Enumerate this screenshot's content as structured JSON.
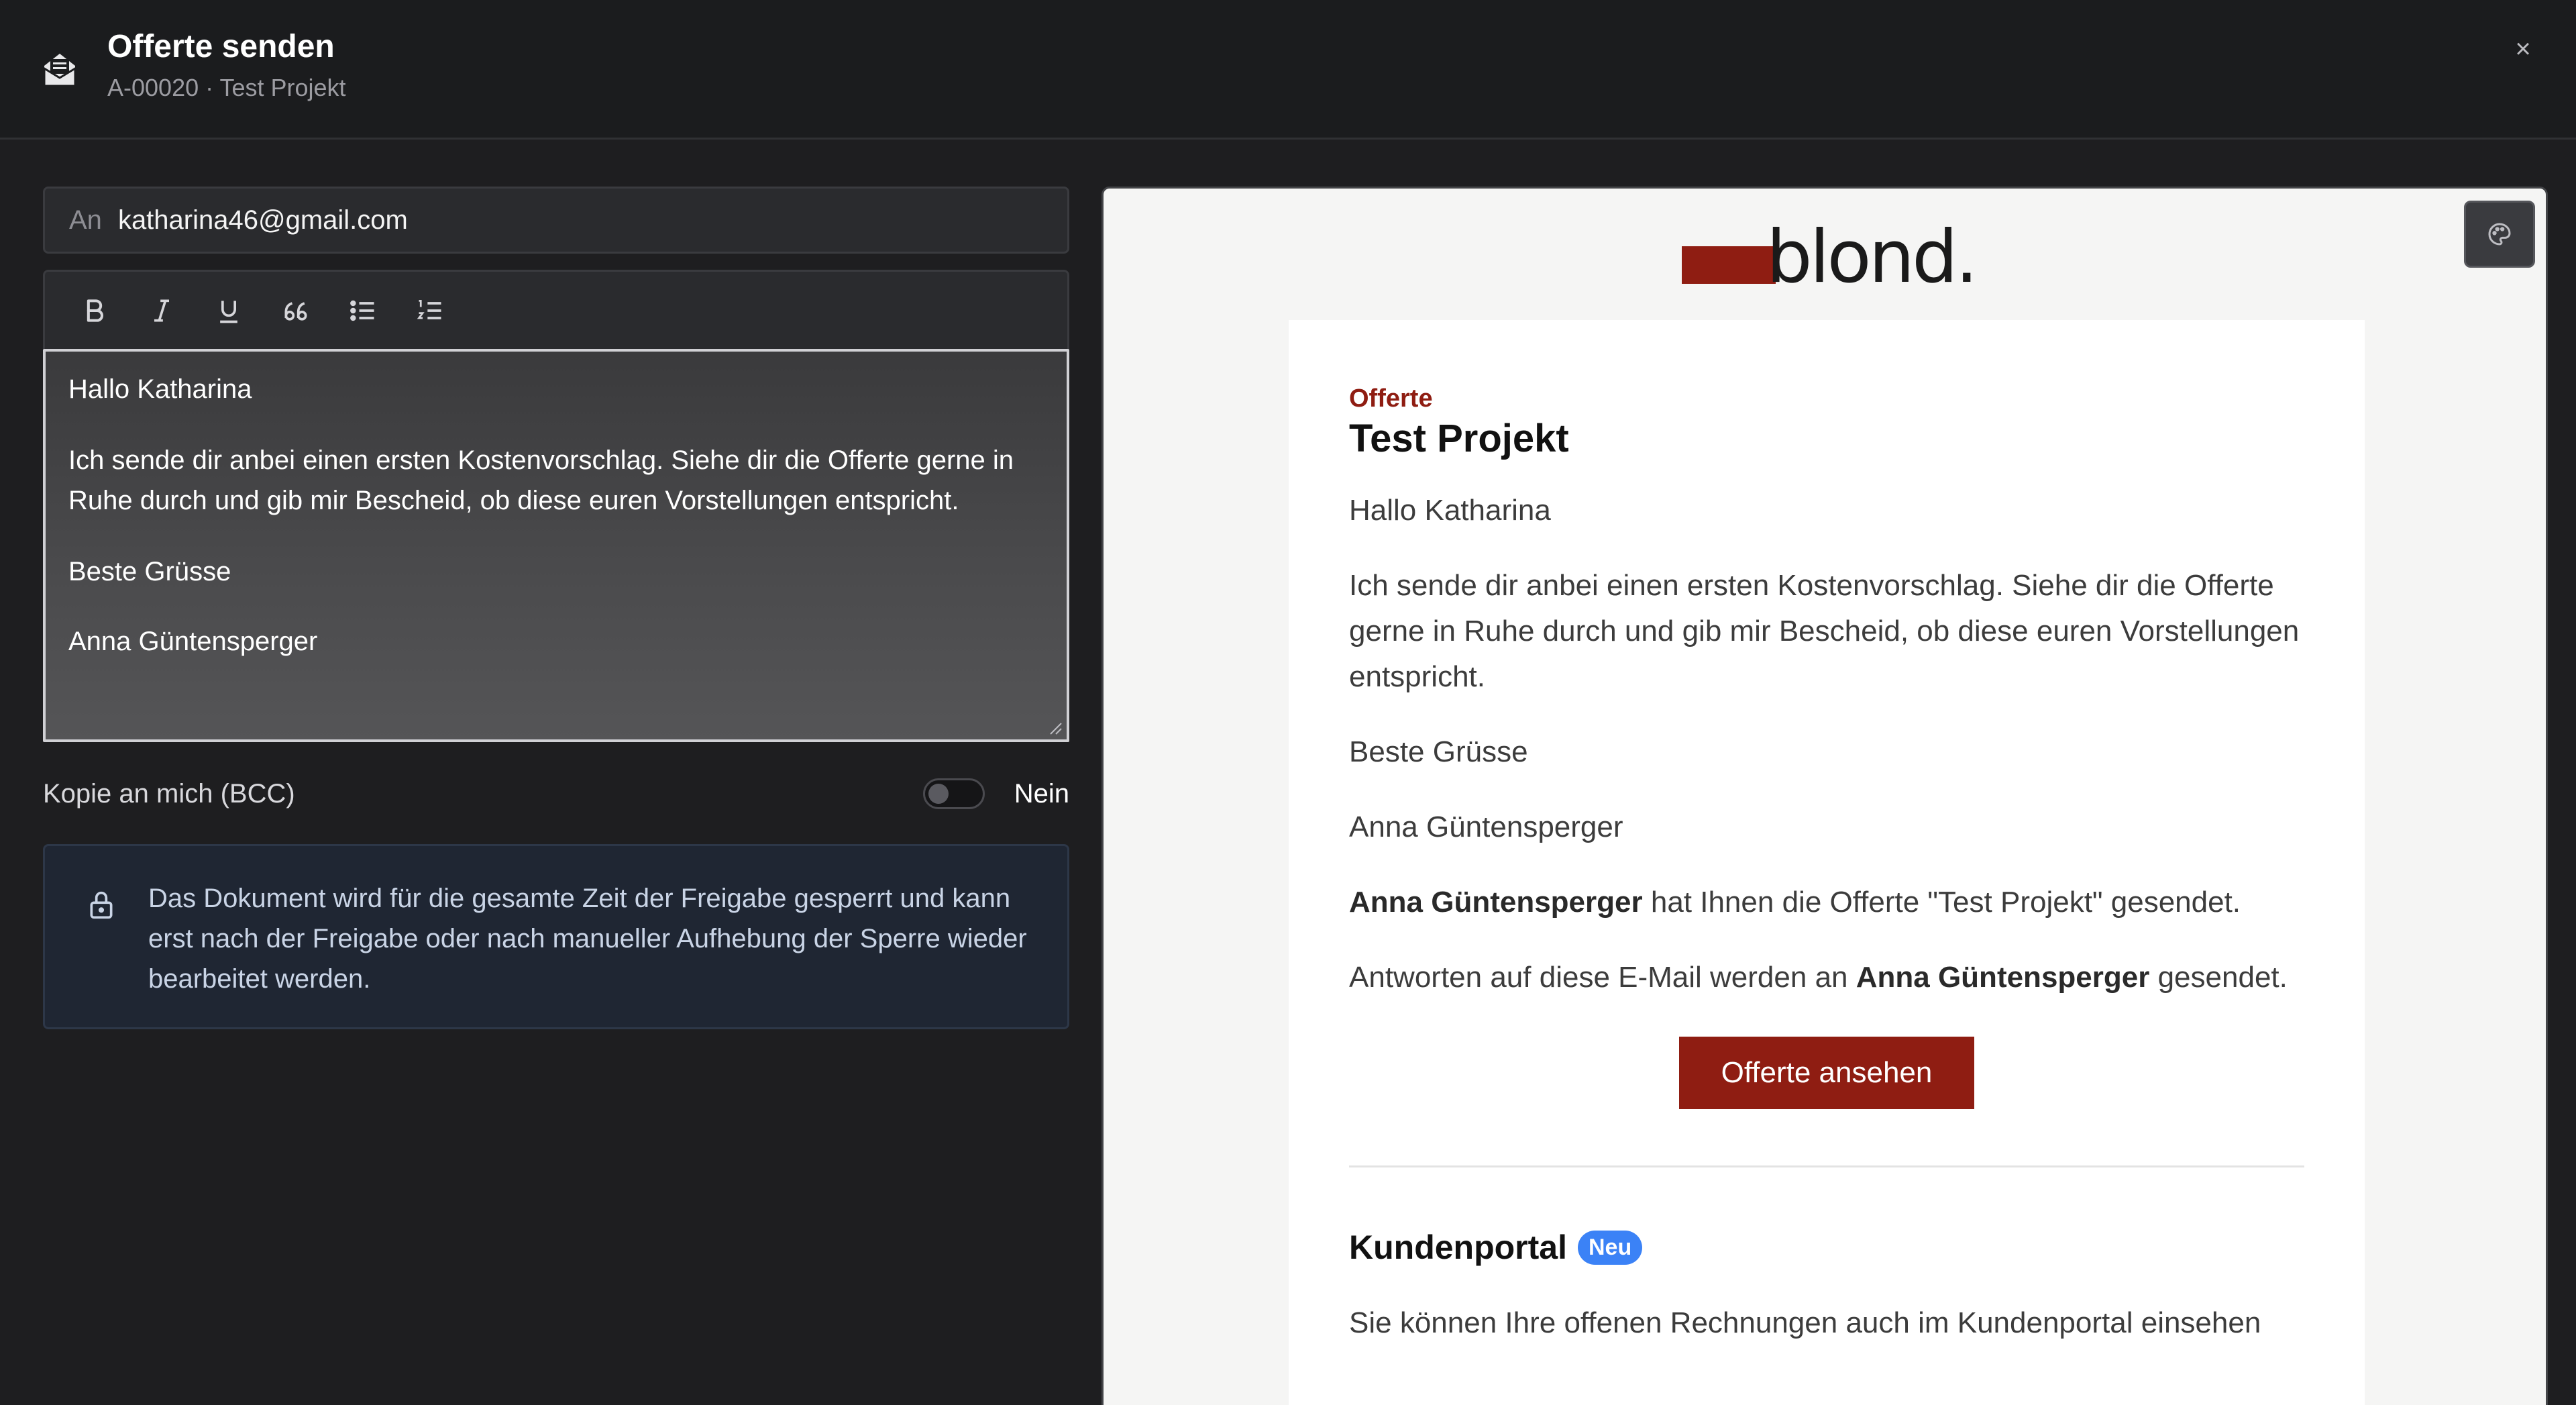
{
  "header": {
    "title": "Offerte senden",
    "subtitle": "A-00020 · Test Projekt",
    "close_glyph": "×",
    "icon": "envelope-open-icon"
  },
  "compose": {
    "to_label": "An",
    "to_value": "katharina46@gmail.com",
    "toolbar": [
      "bold-icon",
      "italic-icon",
      "underline-icon",
      "quote-icon",
      "bullet-list-icon",
      "numbered-list-icon"
    ],
    "body": {
      "greeting": "Hallo Katharina",
      "paragraph": "Ich sende dir anbei einen ersten Kostenvorschlag. Siehe dir die Offerte gerne in Ruhe durch und gib mir Bescheid, ob diese euren Vorstellungen entspricht.",
      "closing": "Beste Grüsse",
      "signature": "Anna Güntensperger"
    },
    "bcc_label": "Kopie an mich (BCC)",
    "bcc_state": "Nein",
    "info_text": "Das Dokument wird für die gesamte Zeit der Freigabe gesperrt und kann erst nach der Freigabe oder nach manueller Aufhebung der Sperre wieder bearbeitet werden."
  },
  "preview": {
    "logo_text": "blond.",
    "brand_color": "#8f1d12",
    "kicker": "Offerte",
    "title": "Test Projekt",
    "greeting": "Hallo Katharina",
    "paragraph": "Ich sende dir anbei einen ersten Kostenvorschlag. Siehe dir die Offerte gerne in Ruhe durch und gib mir Bescheid, ob diese euren Vorstellungen entspricht.",
    "closing": "Beste Grüsse",
    "signature": "Anna Güntensperger",
    "sent_sender": "Anna Güntensperger",
    "sent_rest": " hat Ihnen die Offerte \"Test Projekt\" gesendet.",
    "reply_prefix": "Antworten auf diese E-Mail werden an ",
    "reply_name": "Anna Güntensperger",
    "reply_suffix": " gesendet.",
    "cta_label": "Offerte ansehen",
    "portal_title": "Kundenportal",
    "portal_badge": "Neu",
    "portal_text": "Sie können Ihre offenen Rechnungen auch im Kundenportal einsehen"
  }
}
